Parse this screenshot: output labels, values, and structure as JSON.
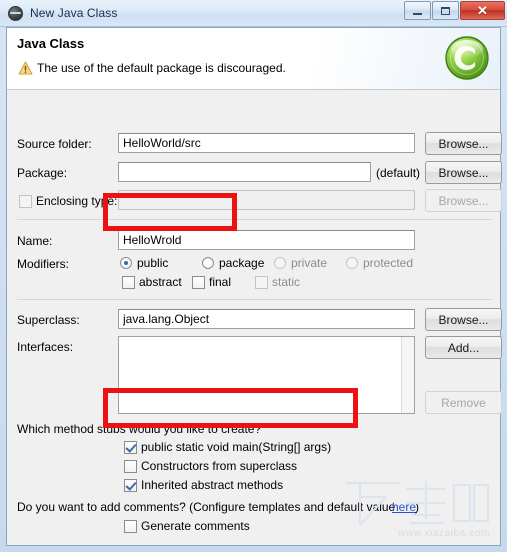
{
  "window": {
    "title": "New Java Class",
    "icon": "java-class-icon",
    "buttons": {
      "minimize": "minimize-icon",
      "maximize": "maximize-icon",
      "close": "✕"
    }
  },
  "header": {
    "title": "Java Class",
    "message": "The use of the default package is discouraged.",
    "warning_icon": "warning-icon",
    "banner_icon": "green-class-c-icon"
  },
  "fields": {
    "source_folder": {
      "label": "Source folder:",
      "value": "HelloWorld/src",
      "browse": "Browse..."
    },
    "package": {
      "label": "Package:",
      "value": "",
      "suffix": "(default)",
      "browse": "Browse..."
    },
    "enclosing_type": {
      "label": "Enclosing type:",
      "value": "",
      "checked": false,
      "browse": "Browse...",
      "disabled": true
    },
    "name": {
      "label": "Name:",
      "value": "HelloWrold"
    },
    "modifiers": {
      "label": "Modifiers:",
      "radios": [
        {
          "label": "public",
          "selected": true,
          "disabled": false
        },
        {
          "label": "package",
          "selected": false,
          "disabled": false
        },
        {
          "label": "private",
          "selected": false,
          "disabled": true
        },
        {
          "label": "protected",
          "selected": false,
          "disabled": true
        }
      ],
      "checkboxes": [
        {
          "label": "abstract",
          "checked": false,
          "disabled": false
        },
        {
          "label": "final",
          "checked": false,
          "disabled": false
        },
        {
          "label": "static",
          "checked": false,
          "disabled": true
        }
      ]
    },
    "superclass": {
      "label": "Superclass:",
      "value": "java.lang.Object",
      "browse": "Browse..."
    },
    "interfaces": {
      "label": "Interfaces:",
      "items": [],
      "add": "Add...",
      "remove": "Remove"
    }
  },
  "stubs": {
    "question": "Which method stubs would you like to create?",
    "options": [
      {
        "label": "public static void main(String[] args)",
        "checked": true
      },
      {
        "label": "Constructors from superclass",
        "checked": false
      },
      {
        "label": "Inherited abstract methods",
        "checked": true
      }
    ]
  },
  "comments": {
    "question_before": "Do you want to add comments? (Configure templates and default value ",
    "link": "here",
    "question_after": ")",
    "checkbox": {
      "label": "Generate comments",
      "checked": false
    }
  },
  "watermark": {
    "logo": "下载吧",
    "url": "www.xiazaiba.com"
  },
  "annotations": {
    "highlight_color": "#ee1111",
    "boxes": [
      {
        "name": "name-field-highlight"
      },
      {
        "name": "main-method-highlight"
      }
    ]
  }
}
